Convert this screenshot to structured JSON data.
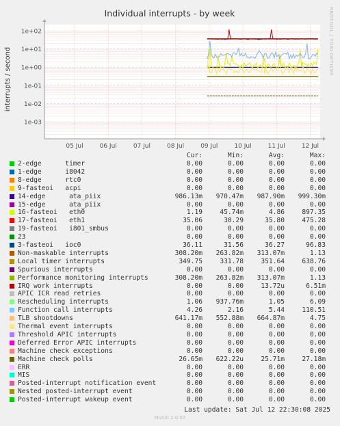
{
  "title": "Individual interrupts - by week",
  "watermark": "RRDTOOL / TOBI OETIKER",
  "chart_data": {
    "type": "line",
    "title": "Individual interrupts - by week",
    "ylabel": "interrupts / second",
    "yscale": "log",
    "ylim": [
      0.0003,
      500
    ],
    "yticks": [
      "1e+02",
      "1e+01",
      "1e+00",
      "1e-01",
      "1e-02",
      "1e-03"
    ],
    "ytick_values": [
      100,
      10,
      1,
      0.1,
      0.01,
      0.001
    ],
    "xticks": [
      "05 Jul",
      "06 Jul",
      "07 Jul",
      "08 Jul",
      "09 Jul",
      "10 Jul",
      "11 Jul",
      "12 Jul"
    ],
    "grid": true,
    "data_start_tick": 4.0,
    "series": [
      {
        "name": "Non-maskable interrupts",
        "color": "#cc7016",
        "level": 0.308,
        "style": "flat"
      },
      {
        "name": "Local timer interrupts",
        "color": "#c8a200",
        "level": 35,
        "style": "flat"
      },
      {
        "name": "Performance monitoring interrupts",
        "color": "#7a7a00",
        "level": 0.308,
        "style": "flat"
      },
      {
        "name": "14-edge ata_piix",
        "color": "#1a1a8c",
        "level": 0.986,
        "style": "flat"
      },
      {
        "name": "3-fasteoi ioc0",
        "color": "#004a6b",
        "level": 36,
        "style": "flat"
      },
      {
        "name": "17-fasteoi eth1",
        "color": "#cc0000",
        "level": 35,
        "style": "spiky"
      },
      {
        "name": "16-fasteoi eth0",
        "color": "#ddee00",
        "level": 1.19,
        "style": "noisy"
      },
      {
        "name": "TLB shootdowns",
        "color": "#ffe066",
        "level": 0.64,
        "style": "noisy"
      },
      {
        "name": "Function call interrupts",
        "color": "#7fb5e6",
        "level": 4.26,
        "style": "noisy"
      },
      {
        "name": "Machine check polls",
        "color": "#555500",
        "level": 0.0266,
        "style": "dashed"
      },
      {
        "name": "IRQ work interrupts",
        "color": "#aa0000",
        "level": 0.0015,
        "style": "drop"
      }
    ]
  },
  "legend": {
    "headers": {
      "cur": "Cur:",
      "min": "Min:",
      "avg": "Avg:",
      "max": "Max:"
    },
    "rows": [
      {
        "label": "2-edge      timer",
        "color": "#00cc00",
        "cur": "0.00",
        "min": "0.00",
        "avg": "0.00",
        "max": "0.00"
      },
      {
        "label": "1-edge      i8042",
        "color": "#0066b3",
        "cur": "0.00",
        "min": "0.00",
        "avg": "0.00",
        "max": "0.00"
      },
      {
        "label": "8-edge      rtc0",
        "color": "#ff8000",
        "cur": "0.00",
        "min": "0.00",
        "avg": "0.00",
        "max": "0.00"
      },
      {
        "label": "9-fasteoi   acpi",
        "color": "#ffcc00",
        "cur": "0.00",
        "min": "0.00",
        "avg": "0.00",
        "max": "0.00"
      },
      {
        "label": "14-edge      ata_piix",
        "color": "#330099",
        "cur": "986.13m",
        "min": "970.47m",
        "avg": "987.90m",
        "max": "999.30m"
      },
      {
        "label": "15-edge      ata_piix",
        "color": "#990099",
        "cur": "0.00",
        "min": "0.00",
        "avg": "0.00",
        "max": "0.00"
      },
      {
        "label": "16-fasteoi   eth0",
        "color": "#ccff00",
        "cur": "1.19",
        "min": "45.74m",
        "avg": "4.86",
        "max": "897.35"
      },
      {
        "label": "17-fasteoi   eth1",
        "color": "#ff0000",
        "cur": "35.06",
        "min": "30.29",
        "avg": "35.80",
        "max": "475.28"
      },
      {
        "label": "19-fasteoi   i801_smbus",
        "color": "#808080",
        "cur": "0.00",
        "min": "0.00",
        "avg": "0.00",
        "max": "0.00"
      },
      {
        "label": "23",
        "color": "#008f00",
        "cur": "0.00",
        "min": "0.00",
        "avg": "0.00",
        "max": "0.00"
      },
      {
        "label": "3-fasteoi   ioc0",
        "color": "#00487d",
        "cur": "36.11",
        "min": "31.56",
        "avg": "36.27",
        "max": "96.83"
      },
      {
        "label": "Non-maskable interrupts",
        "color": "#b35a00",
        "cur": "308.20m",
        "min": "263.82m",
        "avg": "313.07m",
        "max": "1.13"
      },
      {
        "label": "Local timer interrupts",
        "color": "#b38f00",
        "cur": "349.75",
        "min": "331.78",
        "avg": "351.64",
        "max": "638.76"
      },
      {
        "label": "Spurious interrupts",
        "color": "#6b006b",
        "cur": "0.00",
        "min": "0.00",
        "avg": "0.00",
        "max": "0.00"
      },
      {
        "label": "Performance monitoring interrupts",
        "color": "#8fb300",
        "cur": "308.20m",
        "min": "263.82m",
        "avg": "313.07m",
        "max": "1.13"
      },
      {
        "label": "IRQ work interrupts",
        "color": "#b30000",
        "cur": "0.00",
        "min": "0.00",
        "avg": "13.72u",
        "max": "6.51m"
      },
      {
        "label": "APIC ICR read retries",
        "color": "#bebebe",
        "cur": "0.00",
        "min": "0.00",
        "avg": "0.00",
        "max": "0.00"
      },
      {
        "label": "Rescheduling interrupts",
        "color": "#80ff80",
        "cur": "1.06",
        "min": "937.76m",
        "avg": "1.05",
        "max": "6.09"
      },
      {
        "label": "Function call interrupts",
        "color": "#80c9ff",
        "cur": "4.26",
        "min": "2.16",
        "avg": "5.44",
        "max": "110.51"
      },
      {
        "label": "TLB shootdowns",
        "color": "#ffc080",
        "cur": "641.17m",
        "min": "552.88m",
        "avg": "664.87m",
        "max": "4.75"
      },
      {
        "label": "Thermal event interrupts",
        "color": "#ffe680",
        "cur": "0.00",
        "min": "0.00",
        "avg": "0.00",
        "max": "0.00"
      },
      {
        "label": "Threshold APIC interrupts",
        "color": "#aa80ff",
        "cur": "0.00",
        "min": "0.00",
        "avg": "0.00",
        "max": "0.00"
      },
      {
        "label": "Deferred Error APIC interrupts",
        "color": "#ee00cc",
        "cur": "0.00",
        "min": "0.00",
        "avg": "0.00",
        "max": "0.00"
      },
      {
        "label": "Machine check exceptions",
        "color": "#ff8080",
        "cur": "0.00",
        "min": "0.00",
        "avg": "0.00",
        "max": "0.00"
      },
      {
        "label": "Machine check polls",
        "color": "#666600",
        "cur": "26.65m",
        "min": "622.22u",
        "avg": "25.71m",
        "max": "27.18m"
      },
      {
        "label": "ERR",
        "color": "#ffbfff",
        "cur": "0.00",
        "min": "0.00",
        "avg": "0.00",
        "max": "0.00"
      },
      {
        "label": "MIS",
        "color": "#00ffcc",
        "cur": "0.00",
        "min": "0.00",
        "avg": "0.00",
        "max": "0.00"
      },
      {
        "label": "Posted-interrupt notification event",
        "color": "#cc6699",
        "cur": "0.00",
        "min": "0.00",
        "avg": "0.00",
        "max": "0.00"
      },
      {
        "label": "Nested posted-interrupt event",
        "color": "#999900",
        "cur": "0.00",
        "min": "0.00",
        "avg": "0.00",
        "max": "0.00"
      },
      {
        "label": "Posted-interrupt wakeup event",
        "color": "#00cc00",
        "cur": "0.00",
        "min": "0.00",
        "avg": "0.00",
        "max": "0.00"
      }
    ]
  },
  "footer": {
    "last_update": "Last update: Sat Jul 12 22:30:08 2025",
    "version": "Munin 2.0.57"
  }
}
